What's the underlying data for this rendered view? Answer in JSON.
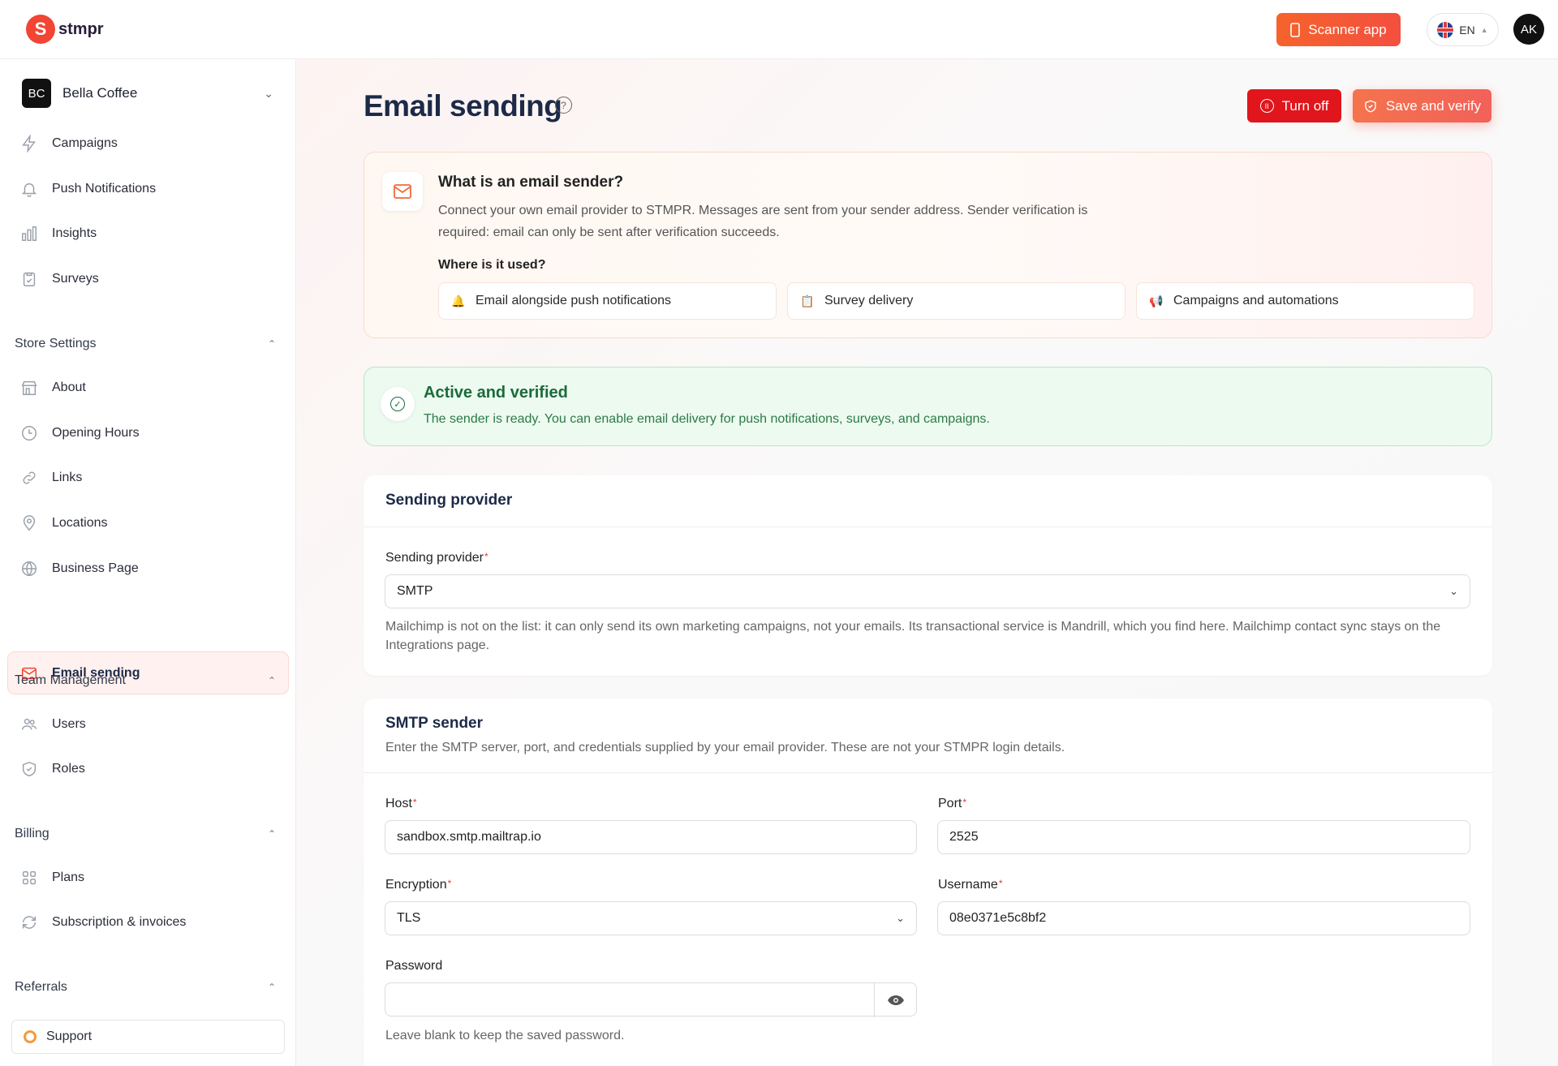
{
  "app": {
    "logo_text": "stmpr",
    "logo_glyph": "S"
  },
  "topbar": {
    "scanner_label": "Scanner app",
    "lang_label": "EN",
    "avatar_initials": "AK"
  },
  "org": {
    "initials": "BC",
    "name": "Bella Coffee"
  },
  "nav": {
    "main": [
      {
        "label": "Campaigns",
        "icon": "lightning-icon"
      },
      {
        "label": "Push Notifications",
        "icon": "bell-icon"
      },
      {
        "label": "Insights",
        "icon": "bar-chart-icon"
      },
      {
        "label": "Surveys",
        "icon": "clipboard-icon"
      }
    ],
    "store_settings": {
      "title": "Store Settings",
      "items": [
        {
          "label": "About",
          "icon": "store-icon"
        },
        {
          "label": "Opening Hours",
          "icon": "clock-icon"
        },
        {
          "label": "Links",
          "icon": "link-icon"
        },
        {
          "label": "Locations",
          "icon": "pin-icon"
        },
        {
          "label": "Business Page",
          "icon": "globe-icon"
        },
        {
          "label": "Email sending",
          "icon": "mail-icon",
          "active": true
        }
      ]
    },
    "team": {
      "title": "Team Management",
      "items": [
        {
          "label": "Users",
          "icon": "users-icon"
        },
        {
          "label": "Roles",
          "icon": "shield-icon"
        }
      ]
    },
    "billing": {
      "title": "Billing",
      "items": [
        {
          "label": "Plans",
          "icon": "grid-icon"
        },
        {
          "label": "Subscription & invoices",
          "icon": "refresh-icon"
        }
      ]
    },
    "referrals": {
      "title": "Referrals"
    },
    "support_label": "Support"
  },
  "page": {
    "title": "Email sending",
    "turn_off_label": "Turn off",
    "save_label": "Save and verify"
  },
  "info": {
    "title": "What is an email sender?",
    "description": "Connect your own email provider to STMPR. Messages are sent from your sender address. Sender verification is required: email can only be sent after verification succeeds.",
    "subtitle": "Where is it used?",
    "uses": [
      "Email alongside push notifications",
      "Survey delivery",
      "Campaigns and automations"
    ]
  },
  "status": {
    "title": "Active and verified",
    "description": "The sender is ready. You can enable email delivery for push notifications, surveys, and campaigns."
  },
  "provider_panel": {
    "title": "Sending provider",
    "field_label": "Sending provider",
    "value": "SMTP",
    "hint": "Mailchimp is not on the list: it can only send its own marketing campaigns, not your emails. Its transactional service is Mandrill, which you find here. Mailchimp contact sync stays on the Integrations page."
  },
  "smtp_panel": {
    "title": "SMTP sender",
    "subtitle": "Enter the SMTP server, port, and credentials supplied by your email provider. These are not your STMPR login details.",
    "host_label": "Host",
    "host_value": "sandbox.smtp.mailtrap.io",
    "port_label": "Port",
    "port_value": "2525",
    "encryption_label": "Encryption",
    "encryption_value": "TLS",
    "username_label": "Username",
    "username_value": "08e0371e5c8bf2",
    "password_label": "Password",
    "password_value": "",
    "password_hint": "Leave blank to keep the saved password."
  },
  "colors": {
    "accent": "#f24533",
    "danger": "#e1161c",
    "success": "#1b6b3a"
  }
}
